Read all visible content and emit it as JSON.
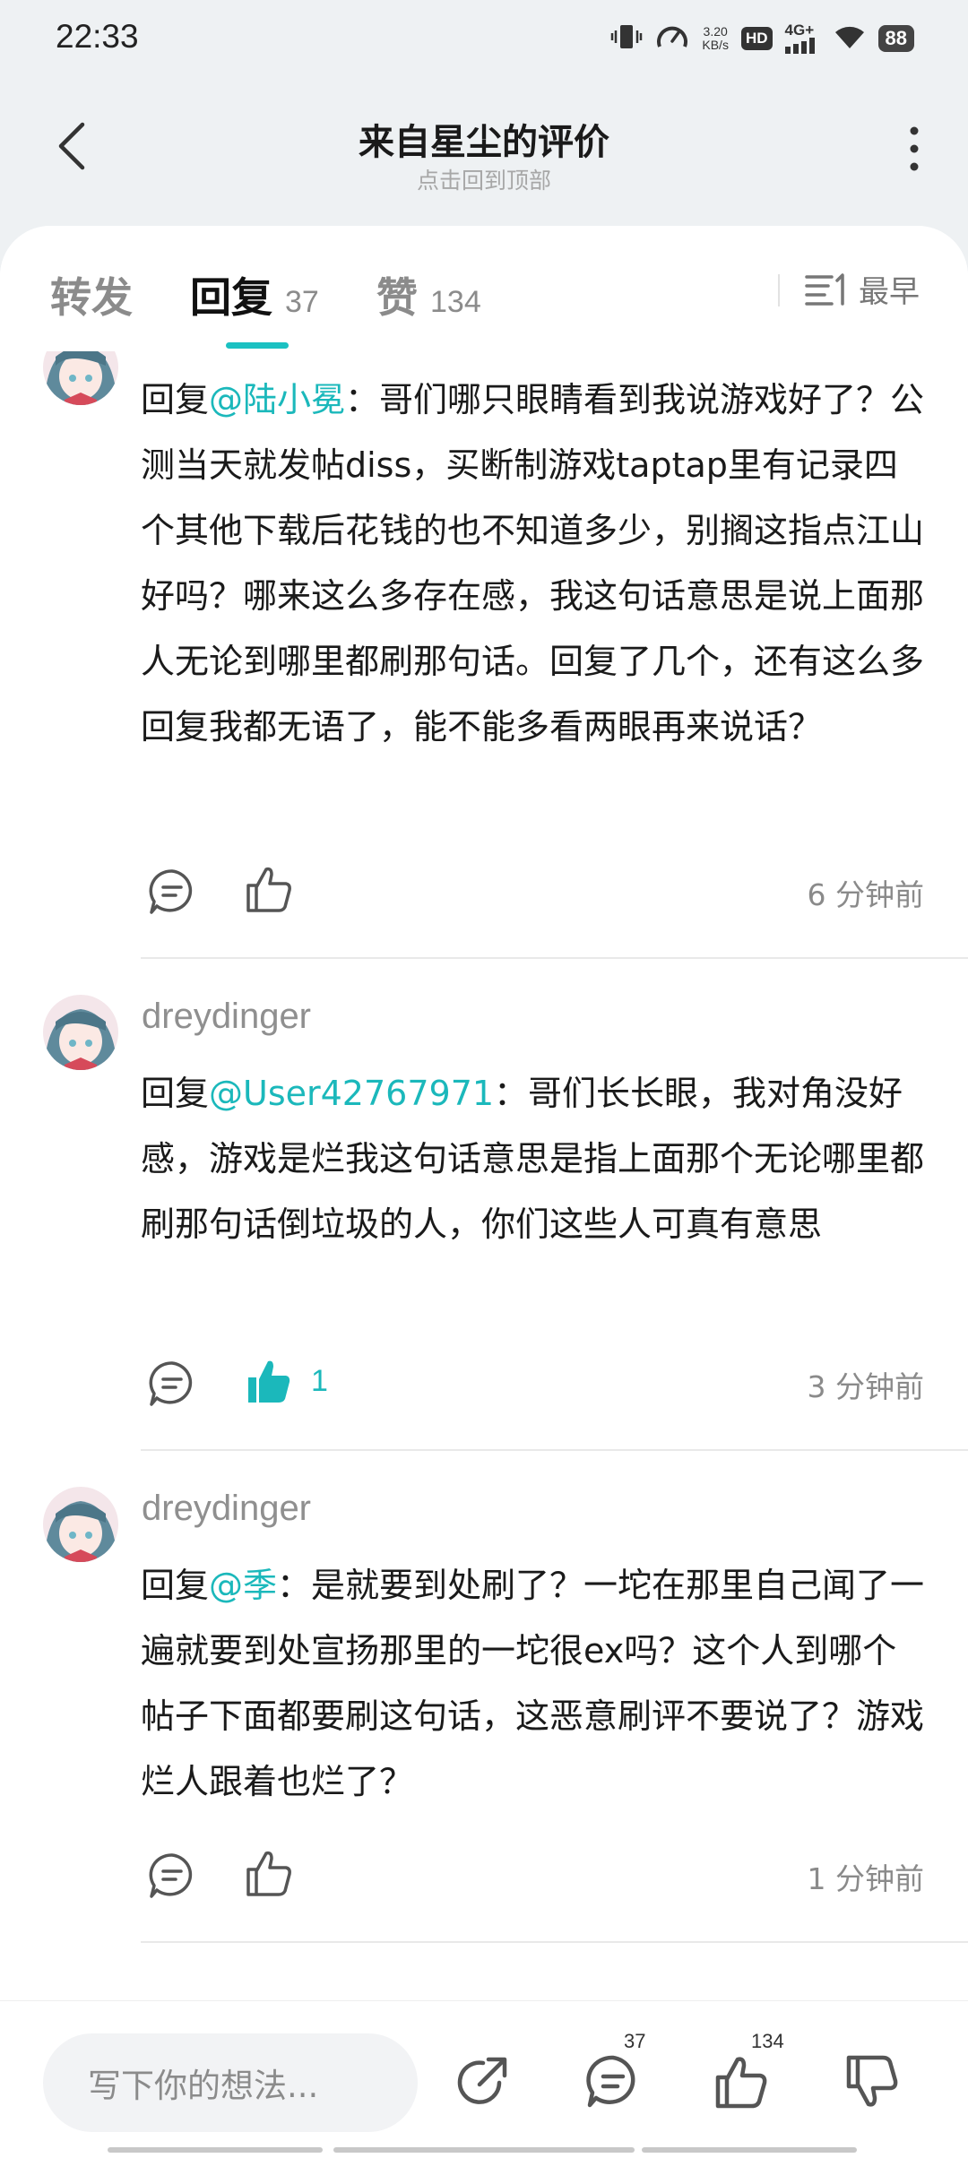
{
  "status_bar": {
    "time": "22:33",
    "speed_value": "3.20",
    "speed_unit": "KB/s",
    "hd": "HD",
    "network": "4G+",
    "battery": "88"
  },
  "header": {
    "title": "来自星尘的评价",
    "subtitle": "点击回到顶部"
  },
  "tabs": [
    {
      "label": "转发",
      "count": ""
    },
    {
      "label": "回复",
      "count": "37"
    },
    {
      "label": "赞",
      "count": "134"
    }
  ],
  "sort": {
    "label": "最早"
  },
  "comments": [
    {
      "author": "",
      "reply_prefix": "回复",
      "mention": "@陆小冕",
      "text": "：哥们哪只眼睛看到我说游戏好了？公测当天就发帖diss，买断制游戏taptap里有记录四个其他下载后花钱的也不知道多少，别搁这指点江山好吗？哪来这么多存在感，我这句话意思是说上面那人无论到哪里都刷那句话。回复了几个，还有这么多回复我都无语了，能不能多看两眼再来说话？",
      "like_count": "",
      "liked": false,
      "time": "6 分钟前"
    },
    {
      "author": "dreydinger",
      "reply_prefix": "回复",
      "mention": "@User42767971",
      "text": "：哥们长长眼，我对角没好感，游戏是烂我这句话意思是指上面那个无论哪里都刷那句话倒垃圾的人，你们这些人可真有意思",
      "like_count": "1",
      "liked": true,
      "time": "3 分钟前"
    },
    {
      "author": "dreydinger",
      "reply_prefix": "回复",
      "mention": "@季",
      "text": "：是就要到处刷了？一坨在那里自己闻了一遍就要到处宣扬那里的一坨很ex吗？这个人到哪个帖子下面都要刷这句话，这恶意刷评不要说了？游戏烂人跟着也烂了？",
      "like_count": "",
      "liked": false,
      "time": "1 分钟前"
    }
  ],
  "bottom_bar": {
    "placeholder": "写下你的想法...",
    "reply_count": "37",
    "like_count": "134"
  },
  "colors": {
    "accent": "#1bc1c2",
    "mention": "#1bb8bb",
    "background": "#eef1f3"
  }
}
